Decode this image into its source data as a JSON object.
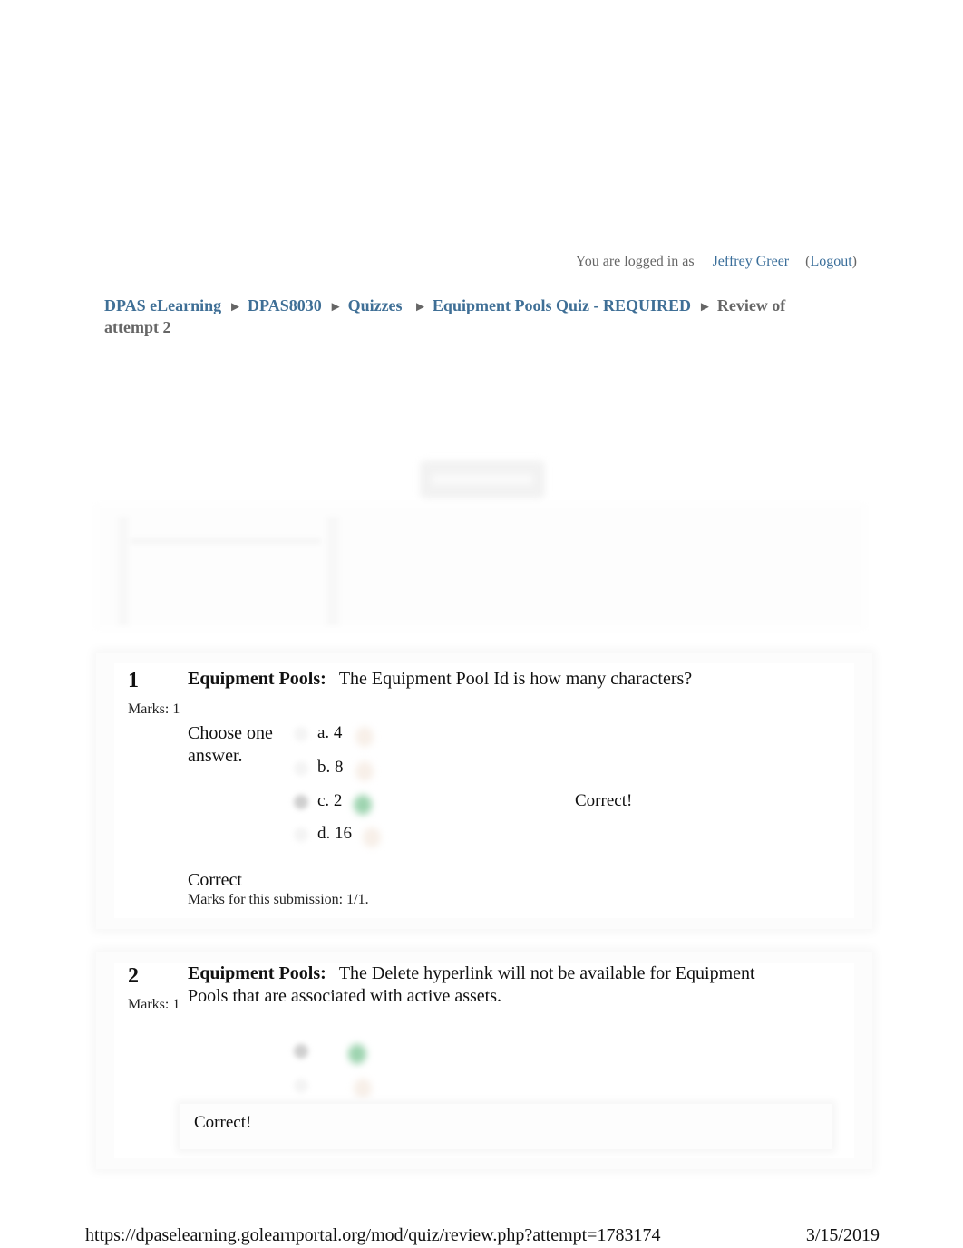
{
  "header": {
    "login_prefix": "You are logged in as",
    "user_name": "Jeffrey Greer",
    "logout_label": "Logout"
  },
  "breadcrumb": {
    "items": [
      "DPAS eLearning",
      "DPAS8030",
      "Quizzes",
      "Equipment Pools Quiz - REQUIRED"
    ],
    "separator": "►",
    "current": "Review of attempt 2"
  },
  "questions": [
    {
      "number": "1",
      "marks": "Marks: 1",
      "topic": "Equipment Pools:",
      "text": "The Equipment Pool Id is how many characters?",
      "prompt": "Choose one answer.",
      "options": [
        {
          "label": "a. 4",
          "selected": false,
          "correct": false
        },
        {
          "label": "b. 8",
          "selected": false,
          "correct": false
        },
        {
          "label": "c. 2",
          "selected": true,
          "correct": true
        },
        {
          "label": "d. 16",
          "selected": false,
          "correct": false
        }
      ],
      "feedback": "Correct!",
      "result": "Correct",
      "result_detail": "Marks for this submission: 1/1."
    },
    {
      "number": "2",
      "marks": "Marks: 1",
      "topic": "Equipment Pools:",
      "text": "The Delete hyperlink will not be available for Equipment Pools that are associated with active assets.",
      "options": [
        {
          "label": "",
          "selected": true,
          "correct": true
        },
        {
          "label": "",
          "selected": false,
          "correct": false
        }
      ],
      "feedback": "Correct!"
    }
  ],
  "footer": {
    "url": "https://dpaselearning.golearnportal.org/mod/quiz/review.php?attempt=1783174",
    "date": "3/15/2019"
  }
}
